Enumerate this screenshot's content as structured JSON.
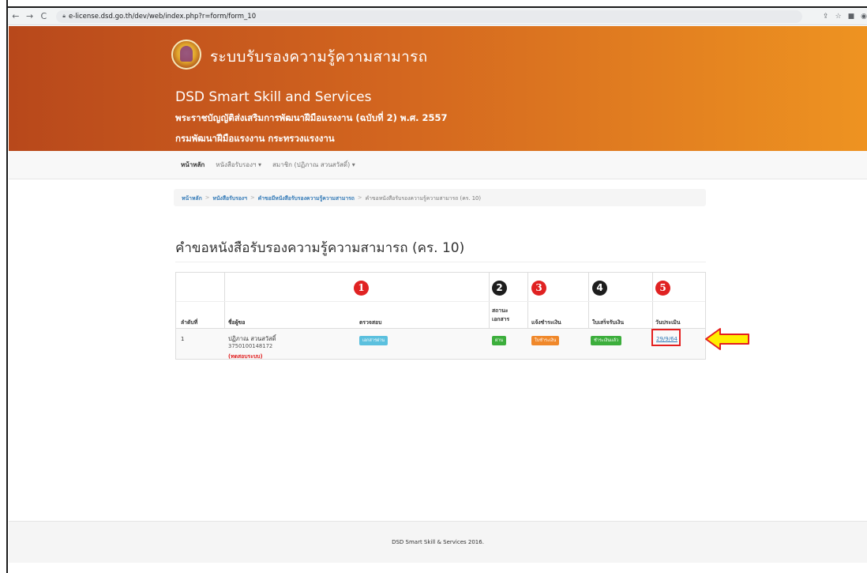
{
  "browser": {
    "url": "e-license.dsd.go.th/dev/web/index.php?r=form/form_10"
  },
  "header": {
    "site_title": "ระบบรับรองความรู้ความสามารถ",
    "line1": "DSD Smart Skill and Services",
    "line2": "พระราชบัญญัติส่งเสริมการพัฒนาฝีมือแรงงาน (ฉบับที่ 2) พ.ศ. 2557",
    "line3": "กรมพัฒนาฝีมือแรงงาน กระทรวงแรงงาน"
  },
  "navbar": {
    "home": "หน้าหลัก",
    "certificates": "หนังสือรับรองฯ ▾",
    "member": "สมาชิก (ปฏิภาณ สวนสวัสดิ์) ▾"
  },
  "breadcrumb": {
    "home": "หน้าหลัก",
    "certificates": "หนังสือรับรองฯ",
    "request": "คำขอมีหนังสือรับรองความรู้ความสามารถ",
    "current": "คำขอหนังสือรับรองความรู้ความสามารถ (คร. 10)",
    "sep": ">"
  },
  "page_title": "คำขอหนังสือรับรองความรู้ความสามารถ (คร. 10)",
  "table": {
    "step_numbers": [
      "1",
      "2",
      "3",
      "4",
      "5"
    ],
    "headers": {
      "order": "ลำดับที่",
      "name": "ชื่อผู้ขอ",
      "check": "ตรวจสอบ",
      "doc_status_1": "สถานะ",
      "doc_status_2": "เอกสาร",
      "payment_notice": "แจ้งชำระเงิน",
      "receipt": "ใบเสร็จรับเงิน",
      "eval_date": "วันประเมิน"
    },
    "row": {
      "order": "1",
      "name": "ปฏิภาณ สวนสวัสดิ์",
      "id": "3750100148172",
      "note": "(ทดสอบระบบ)",
      "check_badge": "เอกสารผ่าน",
      "doc_badge": "ผ่าน",
      "payment_badge": "ใบชำระเงิน",
      "receipt_badge": "ชำระเงินแล้ว",
      "eval_date": "29/9/64"
    }
  },
  "footer": "DSD Smart Skill & Services 2016.",
  "colors": {
    "header_start": "#b8481b",
    "header_end": "#ee9321",
    "link": "#337ab7",
    "badge_info": "#5bc0de",
    "badge_success": "#3cae3c",
    "badge_warning": "#f0882a",
    "highlight_red": "#e41f1f",
    "arrow_yellow": "#ffee00"
  }
}
